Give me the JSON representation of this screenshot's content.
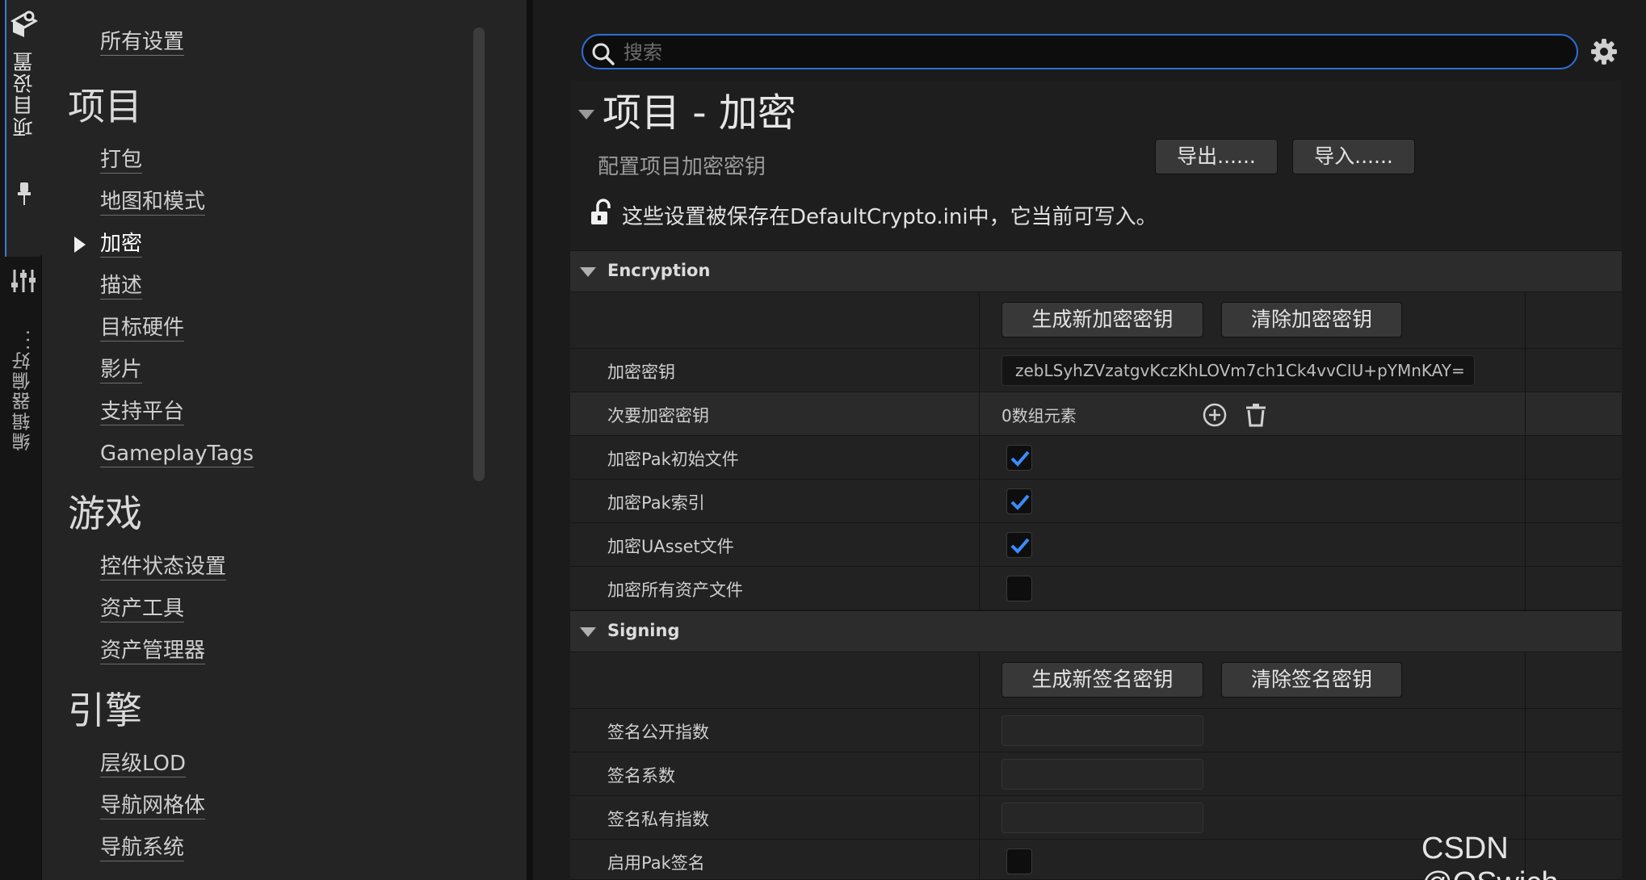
{
  "left_strip": {
    "tabs": [
      {
        "label": "项目设置",
        "icon": "settings-cube-icon"
      },
      {
        "label": "编辑器偏好...",
        "icon": "sliders-icon"
      }
    ],
    "pin_icon": "pin-icon"
  },
  "nav": {
    "all_settings": "所有设置",
    "categories": [
      {
        "title": "项目",
        "items": [
          "打包",
          "地图和模式",
          "加密",
          "描述",
          "目标硬件",
          "影片",
          "支持平台",
          "GameplayTags"
        ]
      },
      {
        "title": "游戏",
        "items": [
          "控件状态设置",
          "资产工具",
          "资产管理器"
        ]
      },
      {
        "title": "引擎",
        "items": [
          "层级LOD",
          "导航网格体",
          "导航系统"
        ]
      }
    ],
    "selected": "加密"
  },
  "search": {
    "placeholder": "搜索",
    "value": ""
  },
  "header": {
    "title": "项目 - 加密",
    "subtitle": "配置项目加密密钥",
    "export_label": "导出......",
    "import_label": "导入......",
    "save_note": "这些设置被保存在DefaultCrypto.ini中，它当前可写入。"
  },
  "encryption": {
    "section_title": "Encryption",
    "gen_key_label": "生成新加密密钥",
    "clear_key_label": "清除加密密钥",
    "key_label": "加密密钥",
    "key_value": "zebLSyhZVzatgvKczKhLOVm7ch1Ck4vvCIU+pYMnKAY=",
    "secondary_label": "次要加密密钥",
    "secondary_value": "0数组元素",
    "checkboxes": [
      {
        "label": "加密Pak初始文件",
        "checked": true
      },
      {
        "label": "加密Pak索引",
        "checked": true
      },
      {
        "label": "加密UAsset文件",
        "checked": true
      },
      {
        "label": "加密所有资产文件",
        "checked": false
      }
    ]
  },
  "signing": {
    "section_title": "Signing",
    "gen_key_label": "生成新签名密钥",
    "clear_key_label": "清除签名密钥",
    "fields": [
      "签名公开指数",
      "签名系数",
      "签名私有指数"
    ],
    "pak_sign_label": "启用Pak签名",
    "pak_sign_checked": false
  },
  "watermark": "CSDN @OSwich",
  "colors": {
    "accent": "#2d6fd6",
    "check": "#3a8cff"
  }
}
